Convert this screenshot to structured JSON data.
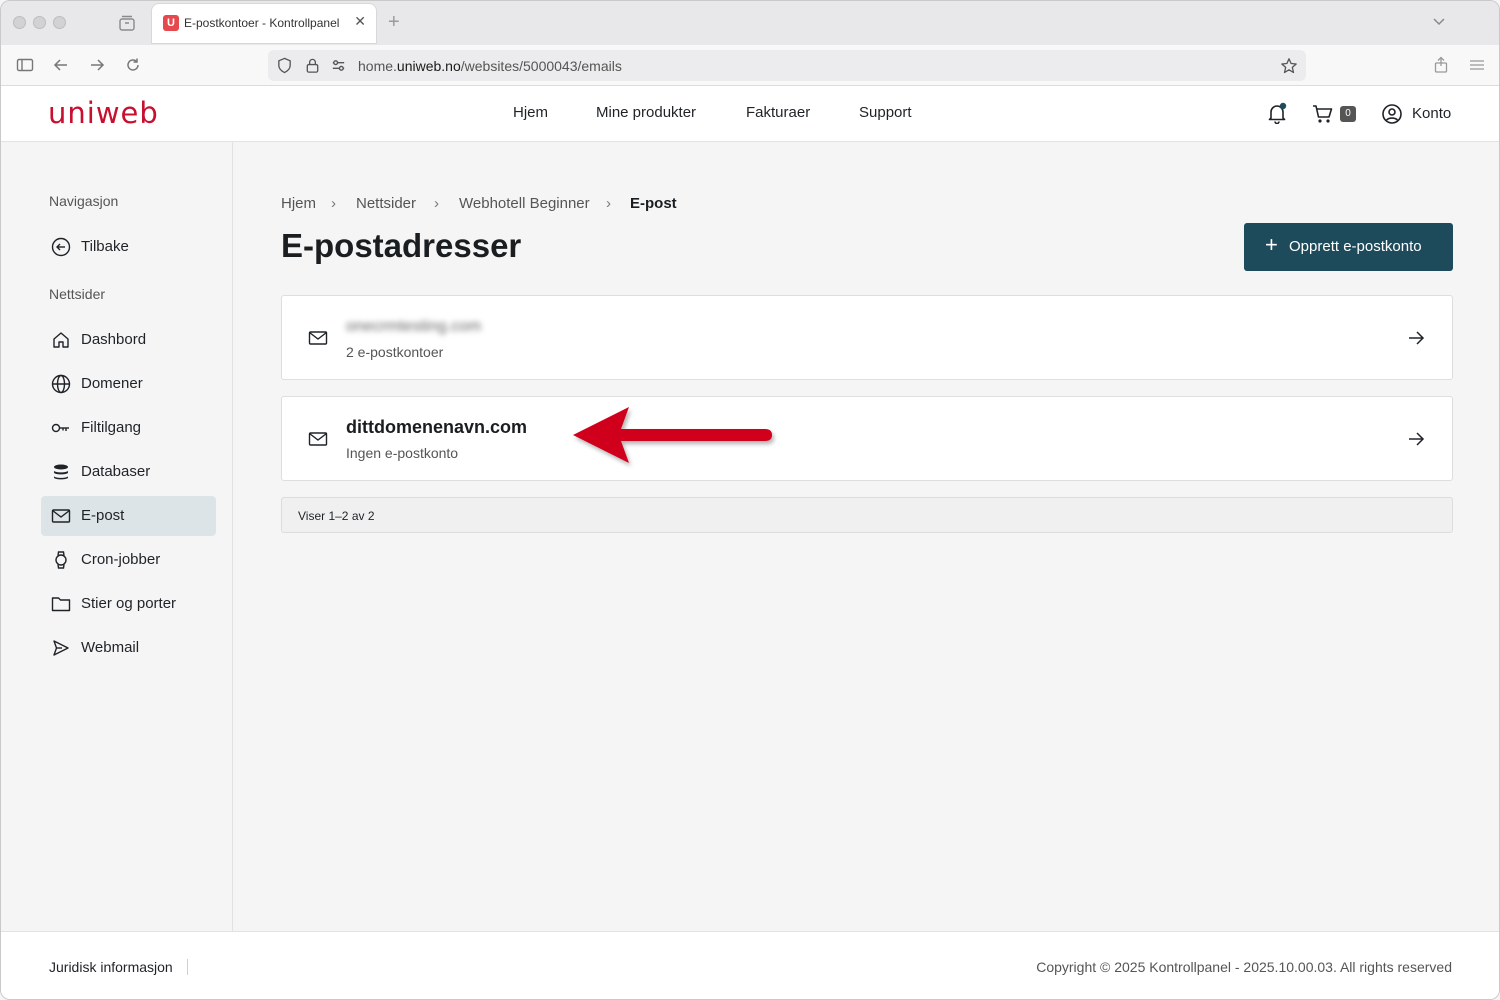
{
  "browser": {
    "tab_title": "E-postkontoer - Kontrollpanel",
    "tab_favicon": "U",
    "url_prefix": "home.",
    "url_domain": "uniweb.no",
    "url_path": "/websites/5000043/emails"
  },
  "header": {
    "logo": "uniweb",
    "nav": [
      "Hjem",
      "Mine produkter",
      "Fakturaer",
      "Support"
    ],
    "cart_count": "0",
    "account_label": "Konto"
  },
  "sidebar": {
    "heading_nav": "Navigasjon",
    "back_label": "Tilbake",
    "heading_sites": "Nettsider",
    "items": [
      {
        "label": "Dashbord",
        "icon": "home-icon"
      },
      {
        "label": "Domener",
        "icon": "globe-icon"
      },
      {
        "label": "Filtilgang",
        "icon": "key-icon"
      },
      {
        "label": "Databaser",
        "icon": "database-icon"
      },
      {
        "label": "E-post",
        "icon": "mail-icon"
      },
      {
        "label": "Cron-jobber",
        "icon": "watch-icon"
      },
      {
        "label": "Stier og porter",
        "icon": "folder-icon"
      },
      {
        "label": "Webmail",
        "icon": "send-icon"
      }
    ],
    "active": "E-post"
  },
  "breadcrumb": [
    "Hjem",
    "Nettsider",
    "Webhotell Beginner",
    "E-post"
  ],
  "page_title": "E-postadresser",
  "create_button": "Opprett e-postkonto",
  "domains": [
    {
      "name": "onecrmtesting.com",
      "sub": "2 e-postkontoer",
      "blurred": true
    },
    {
      "name": "dittdomenenavn.com",
      "sub": "Ingen e-postkonto",
      "blurred": false
    }
  ],
  "pager_text": "Viser 1–2 av 2",
  "footer": {
    "legal": "Juridisk informasjon",
    "copyright": "Copyright © 2025 Kontrollpanel - 2025.10.00.03. All rights reserved"
  },
  "colors": {
    "brand_red": "#c8102e",
    "primary_button": "#1e4b5b",
    "active_sidebar": "#dde4e8",
    "annotation_arrow": "#d0021b"
  }
}
